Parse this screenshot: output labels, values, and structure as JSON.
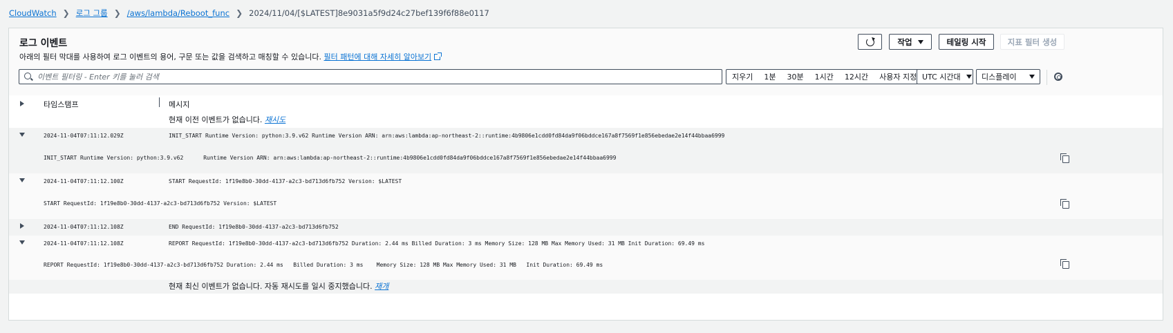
{
  "breadcrumb": {
    "items": [
      "CloudWatch",
      "로그 그룹",
      "/aws/lambda/Reboot_func"
    ],
    "current": "2024/11/04/[$LATEST]8e9031a5f9d24c27bef139f6f88e0117"
  },
  "panel": {
    "title": "로그 이벤트",
    "description": "아래의 필터 막대를 사용하여 로그 이벤트의 용어, 구문 또는 값을 검색하고 매칭할 수 있습니다.",
    "learn_more": "필터 패턴에 대해 자세히 알아보기",
    "buttons": {
      "actions": "작업",
      "tail": "테일링 시작",
      "metric_filter": "지표 필터 생성"
    }
  },
  "search": {
    "placeholder": "이벤트 필터링 - Enter 키를 눌러 검색"
  },
  "time_range": {
    "clear": "지우기",
    "options": [
      "1분",
      "30분",
      "1시간",
      "12시간"
    ],
    "custom": "사용자 지정"
  },
  "timezone": "UTC 시간대",
  "display": "디스플레이",
  "table": {
    "col_timestamp": "타임스탬프",
    "col_message": "메시지",
    "no_older": "현재 이전 이벤트가 없습니다.",
    "retry": "재시도",
    "no_newer": "현재 최신 이벤트가 없습니다. 자동 재시도를 일시 중지했습니다.",
    "resume": "재개",
    "events": [
      {
        "timestamp": "2024-11-04T07:11:12.029Z",
        "message": "INIT_START Runtime Version: python:3.9.v62 Runtime Version ARN: arn:aws:lambda:ap-northeast-2::runtime:4b9806e1cdd0fd84da9f06bddce167a8f7569f1e856ebedae2e14f44bbaa6999",
        "expanded": "INIT_START Runtime Version: python:3.9.v62\tRuntime Version ARN: arn:aws:lambda:ap-northeast-2::runtime:4b9806e1cdd0fd84da9f06bddce167a8f7569f1e856ebedae2e14f44bbaa6999"
      },
      {
        "timestamp": "2024-11-04T07:11:12.100Z",
        "message": "START RequestId: 1f19e8b0-30dd-4137-a2c3-bd713d6fb752 Version: $LATEST",
        "expanded": "START RequestId: 1f19e8b0-30dd-4137-a2c3-bd713d6fb752 Version: $LATEST"
      },
      {
        "timestamp": "2024-11-04T07:11:12.108Z",
        "message": "END RequestId: 1f19e8b0-30dd-4137-a2c3-bd713d6fb752"
      },
      {
        "timestamp": "2024-11-04T07:11:12.108Z",
        "message": "REPORT RequestId: 1f19e8b0-30dd-4137-a2c3-bd713d6fb752 Duration: 2.44 ms Billed Duration: 3 ms Memory Size: 128 MB Max Memory Used: 31 MB Init Duration: 69.49 ms",
        "expanded": "REPORT RequestId: 1f19e8b0-30dd-4137-a2c3-bd713d6fb752\tDuration: 2.44 ms\tBilled Duration: 3 ms\tMemory Size: 128 MB\tMax Memory Used: 31 MB\tInit Duration: 69.49 ms"
      }
    ]
  }
}
